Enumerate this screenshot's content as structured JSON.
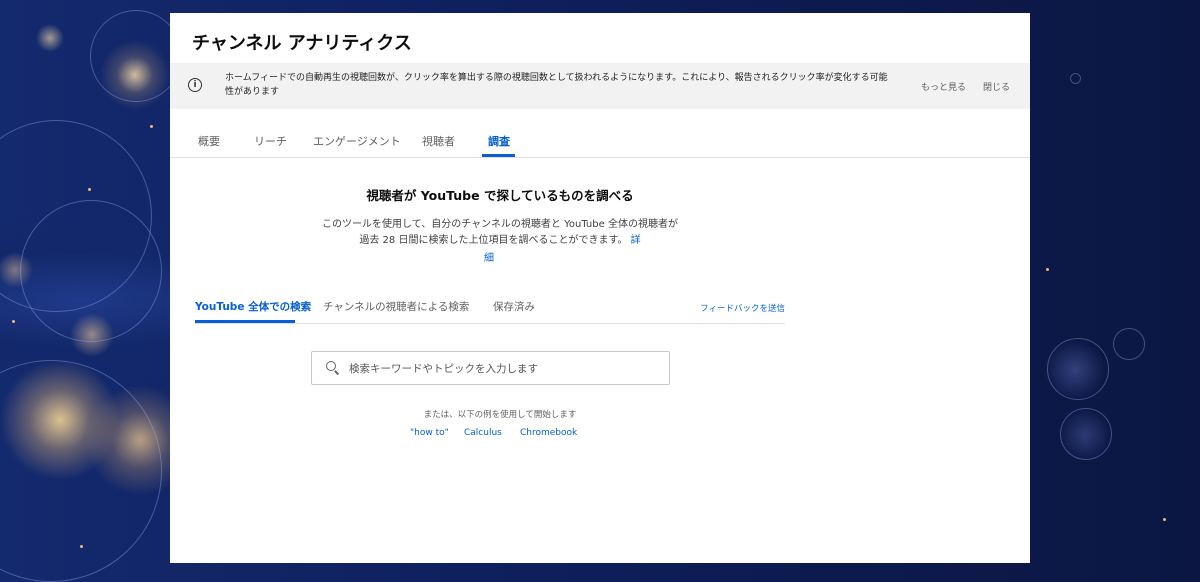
{
  "page": {
    "title": "チャンネル アナリティクス"
  },
  "notice": {
    "text": "ホームフィードでの自動再生の視聴回数が、クリック率を算出する際の視聴回数として扱われるようになります。これにより、報告されるクリック率が変化する可能性があります",
    "more_label": "もっと見る",
    "close_label": "閉じる",
    "icon": "info-icon"
  },
  "tabs": [
    {
      "label": "概要"
    },
    {
      "label": "リーチ"
    },
    {
      "label": "エンゲージメント"
    },
    {
      "label": "視聴者"
    },
    {
      "label": "調査",
      "active": true
    }
  ],
  "research": {
    "heading": "視聴者が YouTube で探しているものを調べる",
    "description": "このツールを使用して、自分のチャンネルの視聴者と YouTube 全体の視聴者が過去 28 日間に検索した上位項目を調べることができます。",
    "details_link": "詳",
    "details_link_2": "細",
    "subtabs": [
      {
        "label": "YouTube 全体での検索",
        "active": true
      },
      {
        "label": "チャンネルの視聴者による検索"
      },
      {
        "label": "保存済み"
      }
    ],
    "feedback_label": "フィードバックを送信",
    "search": {
      "placeholder": "検索キーワードやトピックを入力します",
      "value": "",
      "icon": "search-icon"
    },
    "examples_label": "または、以下の例を使用して開始します",
    "examples": [
      "\"how to\"",
      "Calculus",
      "Chromebook"
    ]
  },
  "colors": {
    "accent": "#065fd4",
    "panel_bg": "#ffffff",
    "notice_bg": "#f2f2f2"
  }
}
